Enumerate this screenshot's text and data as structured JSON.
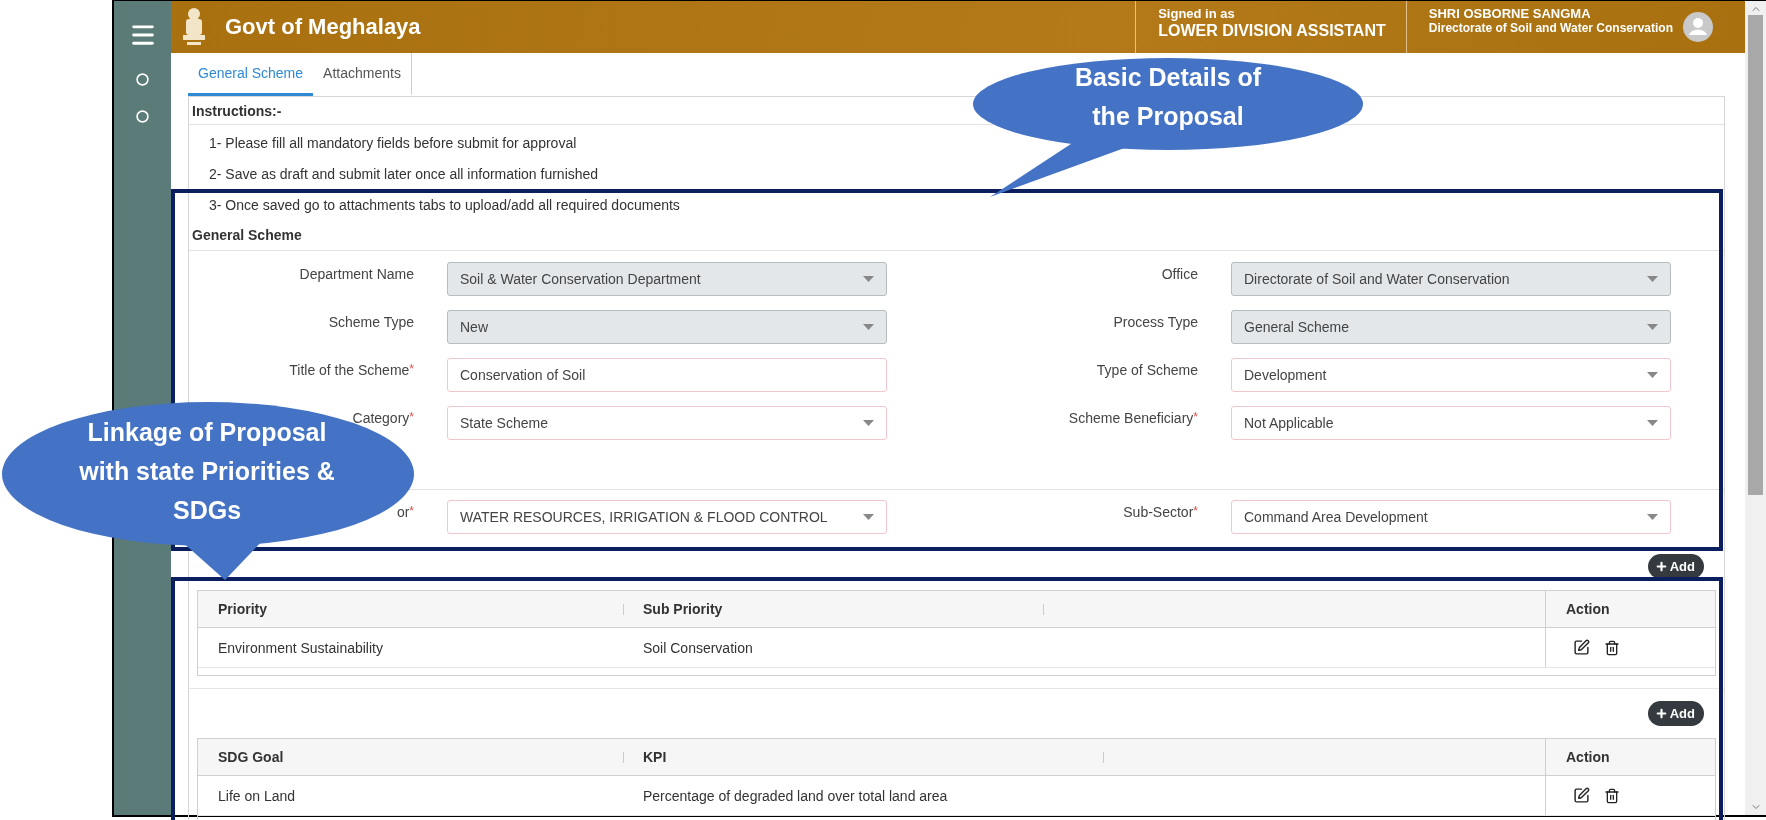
{
  "header": {
    "title": "Govt of Meghalaya",
    "signed_in_label": "Signed in as",
    "role": "LOWER DIVISION ASSISTANT",
    "user_name": "SHRI OSBORNE SANGMA",
    "user_office": "Directorate of Soil and Water Conservation"
  },
  "tabs": [
    {
      "label": "General Scheme",
      "selected": true
    },
    {
      "label": "Attachments",
      "selected": false
    }
  ],
  "instructions": {
    "heading": "Instructions:-",
    "items": [
      "1- Please fill all mandatory fields before submit for approval",
      "2- Save as draft and submit later once all information furnished",
      "3- Once saved go to attachments tabs to upload/add all required documents"
    ]
  },
  "general_scheme": {
    "heading": "General Scheme",
    "field_groups": [
      [
        {
          "label": "Department Name",
          "kind": "select",
          "value": "Soil & Water Conservation Department",
          "disabled": true
        },
        {
          "label": "Office",
          "kind": "select",
          "value": "Directorate of Soil and Water Conservation",
          "disabled": true
        },
        {
          "label": "Scheme Type",
          "kind": "select",
          "value": "New",
          "disabled": true
        },
        {
          "label": "Process Type",
          "kind": "select",
          "value": "General Scheme",
          "disabled": true
        },
        {
          "label": "Title of the Scheme",
          "required_mark": "*",
          "kind": "text",
          "value": "Conservation of Soil",
          "disabled": false
        },
        {
          "label": "Type of Scheme",
          "kind": "select",
          "value": "Development",
          "disabled": false
        },
        {
          "label": "Category",
          "required_mark": "*",
          "kind": "select",
          "value": "State Scheme",
          "disabled": false
        },
        {
          "label": "Scheme Beneficiary",
          "required_mark": "*",
          "kind": "select",
          "value": "Not Applicable",
          "disabled": false
        }
      ],
      [
        {
          "label": "or",
          "required_mark": "*",
          "kind": "select",
          "value": "WATER RESOURCES, IRRIGATION & FLOOD CONTROL",
          "disabled": false
        },
        {
          "label": "Sub-Sector",
          "required_mark": "*",
          "kind": "select",
          "value": "Command Area Development",
          "disabled": false
        }
      ]
    ]
  },
  "priority_table": {
    "add_button": "Add",
    "columns": [
      "Priority",
      "Sub Priority"
    ],
    "action_column": "Action",
    "rows": [
      {
        "cells": [
          "Environment Sustainability",
          "Soil Conservation"
        ]
      }
    ]
  },
  "sdg_table": {
    "add_button": "Add",
    "columns": [
      "SDG Goal",
      "KPI"
    ],
    "action_column": "Action",
    "rows": [
      {
        "cells": [
          "Life on Land",
          "Percentage of degraded land over total land area"
        ]
      }
    ]
  },
  "callouts": [
    {
      "text": "Basic Details of the Proposal"
    },
    {
      "text": "Linkage of Proposal with state Priorities & SDGs"
    }
  ]
}
